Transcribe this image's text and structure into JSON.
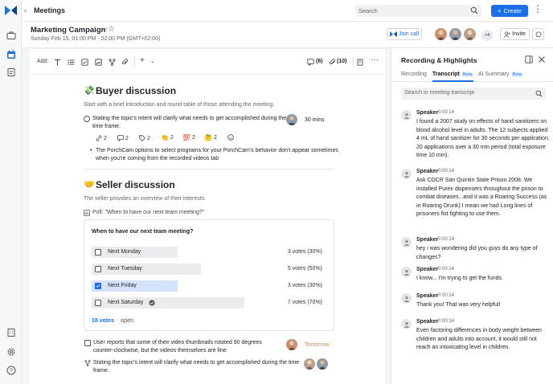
{
  "topbar": {
    "breadcrumb": "Meetings",
    "search_placeholder": "Search",
    "create_label": "Create"
  },
  "meeting": {
    "title": "Marketing Campaign",
    "datetime": "Sunday Feb 15, 01:00 PM - 02:00 PM (GMT+02:00)",
    "join_call_label": "Join call",
    "extra_attendees": "+4",
    "invite_label": "Invite"
  },
  "toolbar": {
    "add_label": "Add:",
    "comments_count": "(6)",
    "attachments_count": "(10)"
  },
  "doc": {
    "buyer": {
      "heading": "Buyer discussion",
      "emoji": "💸",
      "intro": "Start with a brief introduction and round table of those attending the meeting.",
      "item1_text_line1": "Stating the topic's intent will clarify what needs to get accomplished during the",
      "item1_text_line2": "time frame.",
      "item1_duration": "30 mins",
      "meta": [
        "2",
        "2",
        "2",
        "2",
        "2",
        "2"
      ],
      "bullet_line1": "The PorchCam options to select programs for your PorchCam's behavior don't appear sometimes",
      "bullet_line2": "when you're coming from the recorded videos tab"
    },
    "seller": {
      "heading": "Seller discussion",
      "emoji": "🤝",
      "intro": "The seller provides an overview of their interests.",
      "poll_label": "Poll: \"When to have our next team meeting?\""
    },
    "poll": {
      "question": "When to have our next team meeting?",
      "options": [
        {
          "label": "Next Monday",
          "votes": "3 votes (30%)",
          "percent": 30,
          "selected": false
        },
        {
          "label": "Next Tuesday",
          "votes": "5 votes (50%)",
          "percent": 50,
          "selected": false
        },
        {
          "label": "Next Friday",
          "votes": "3 votes (30%)",
          "percent": 30,
          "selected": true
        },
        {
          "label": "Next Saturday",
          "votes": "7 votes (70%)",
          "percent": 70,
          "selected": false
        }
      ],
      "total_votes": "18 votes",
      "separator": "·",
      "status": "open"
    },
    "task1_line1": "User reports that some of their video thumbnails rotated 90 degrees",
    "task1_line2": "counter-clockwise, but the videos themselves are fine",
    "task1_due": "Tomorrow",
    "task2_line1": "Stating the topic's intent will clarify what needs to get accomplished during the time",
    "task2_line2": "frame."
  },
  "panel": {
    "title": "Recording & Highlights",
    "tabs": [
      {
        "label": "Recording",
        "beta": ""
      },
      {
        "label": "Transcript",
        "beta": "Beta"
      },
      {
        "label": "AI Summary",
        "beta": "Beta"
      }
    ],
    "search_placeholder": "Search in meeting transcript",
    "segments": [
      {
        "speaker": "Speaker",
        "time": "0:00:14",
        "text": "I found a 2007 study on effects of hand sanitizers on blood alcohol level in adults. The 12 subjects applied 4 mL of hand sanitizer for 30 seconds per application, 20 applications over a 30 min period (total exposure time 10 min)."
      },
      {
        "speaker": "Speaker",
        "time": "0:00:14",
        "text": "Ask CDCR San Quintin State Prison 2008. We installed Purex dispensers throughout the prison to combat diseases...and it was a Roaring Success (as in Roaring Drunk) I mean we had Long lines of prisoners fist fighting to use them."
      },
      {
        "speaker": "Speaker",
        "time": "0:00:14",
        "text": "hey i was wondering did you guys do any type of changes?"
      },
      {
        "speaker": "Speaker",
        "time": "0:00:14",
        "text": "I know... I'm trying to get the funds."
      },
      {
        "speaker": "Speaker",
        "time": "0:00:14",
        "text": "Thank you! That was very helpful!"
      },
      {
        "speaker": "Speaker",
        "time": "0:00:14",
        "text": "Even factoring differences in body weight between children and adults into account, it would still not reach an intoxicating level in children."
      }
    ]
  },
  "colors": {
    "accent": "#1a6ee6",
    "due": "#e08a2e"
  }
}
